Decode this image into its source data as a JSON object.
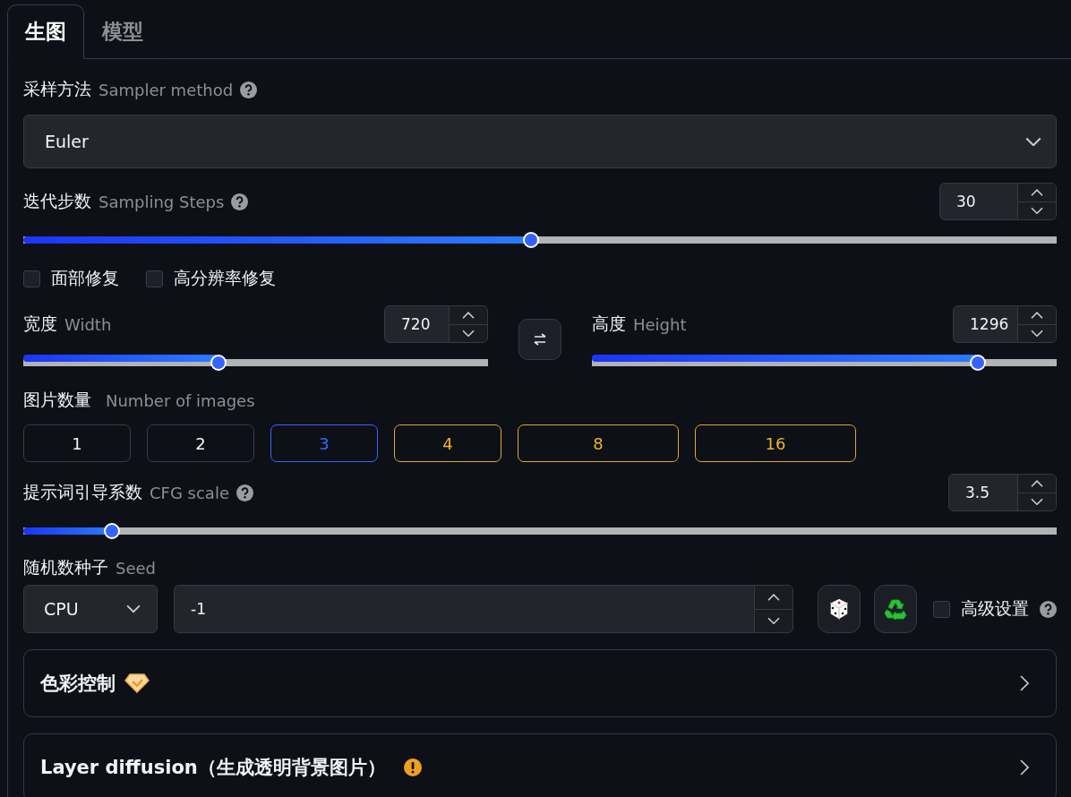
{
  "tabs": [
    {
      "label": "生图",
      "selected": true
    },
    {
      "label": "模型",
      "selected": false
    }
  ],
  "sampler": {
    "label": "采样方法",
    "hint": "Sampler method",
    "help": true,
    "value": "Euler"
  },
  "steps": {
    "label": "迭代步数",
    "hint": "Sampling Steps",
    "help": true,
    "value": "30",
    "level": 0.491
  },
  "options": [
    {
      "label": "面部修复",
      "checked": false
    },
    {
      "label": "高分辨率修复",
      "checked": false
    }
  ],
  "width": {
    "label": "宽度",
    "hint": "Width",
    "help": false,
    "value": "720",
    "level": 0.42
  },
  "height": {
    "label": "高度",
    "hint": "Height",
    "help": false,
    "value": "1296",
    "level": 0.83
  },
  "image_count": {
    "label": "图片数量",
    "hint": "Number of images",
    "options": [
      {
        "label": "1",
        "selected": false,
        "kind": "standard"
      },
      {
        "label": "2",
        "selected": false,
        "kind": "standard"
      },
      {
        "label": "3",
        "selected": true,
        "kind": "standard"
      },
      {
        "label": "4",
        "selected": false,
        "kind": "premium"
      },
      {
        "label": "8",
        "selected": false,
        "kind": "premium"
      },
      {
        "label": "16",
        "selected": false,
        "kind": "premium"
      }
    ]
  },
  "cfg": {
    "label": "提示词引导系数",
    "hint": "CFG scale",
    "help": true,
    "value": "3.5",
    "level": 0.086
  },
  "seed": {
    "label": "随机数种子",
    "hint": "Seed",
    "device": "CPU",
    "value": "-1",
    "advanced": {
      "label": "高级设置",
      "checked": false,
      "help": true
    }
  },
  "sections": [
    {
      "title": "色彩控制",
      "kind": "gem",
      "expanded": false
    },
    {
      "title": "Layer diffusion（生成透明背景图片）",
      "kind": "warning",
      "expanded": false
    }
  ]
}
